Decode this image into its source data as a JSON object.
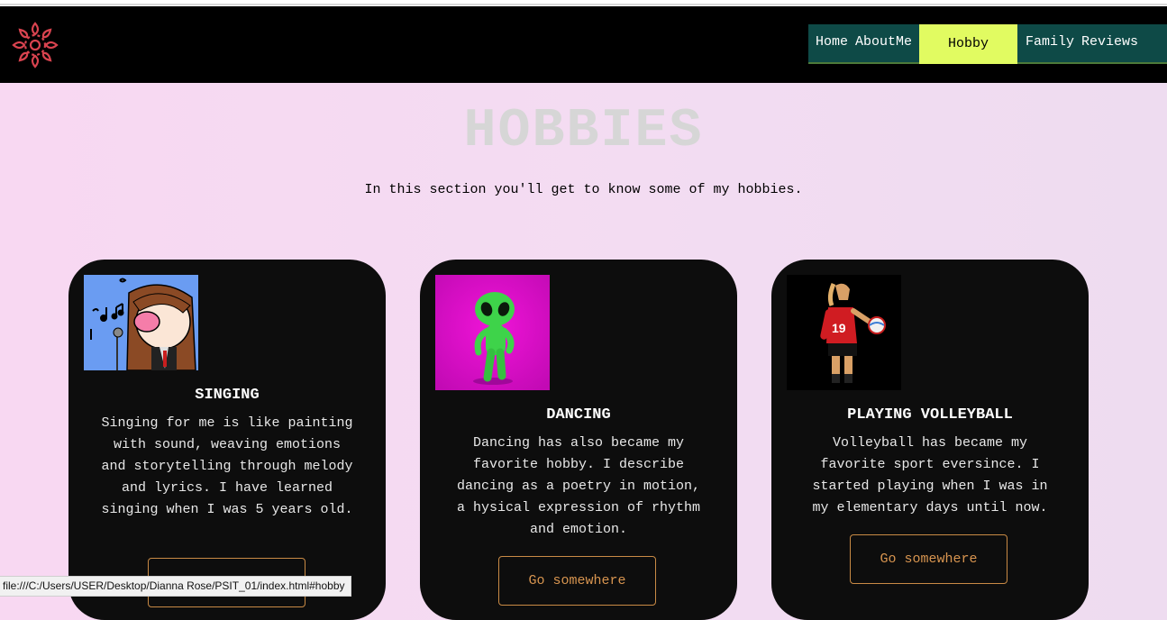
{
  "nav": {
    "items": [
      {
        "label": "Home"
      },
      {
        "label": "AboutMe"
      },
      {
        "label": "Hobby",
        "active": true
      },
      {
        "label": "Family"
      },
      {
        "label": "Reviews"
      }
    ]
  },
  "logo": {
    "icon": "mandala-logo-icon",
    "color": "#d9434f"
  },
  "hero": {
    "title": "HOBBIES",
    "intro": "In this section you'll get to know some of my hobbies."
  },
  "cards": [
    {
      "title": "SINGING",
      "text": "Singing for me is like painting with sound, weaving emotions and storytelling through melody and lyrics. I have learned singing when I was 5 years old.",
      "image": "anime-girl-singing-image"
    },
    {
      "title": "DANCING",
      "text": "Dancing has also became my favorite hobby. I describe dancing as a poetry in motion, a hysical expression of rhythm and emotion.",
      "button": "Go somewhere",
      "image": "green-alien-dancing-image"
    },
    {
      "title": "PLAYING VOLLEYBALL",
      "text": "Volleyball has became my favorite sport eversince. I started playing when I was in my elementary days until now.",
      "button": "Go somewhere",
      "image": "volleyball-player-image"
    }
  ],
  "statusbar": {
    "url": "file:///C:/Users/USER/Desktop/Dianna Rose/PSIT_01/index.html#hobby"
  },
  "colors": {
    "nav_bg": "#0e4a47",
    "nav_active": "#e1fb61",
    "card_bg": "#0d0d0d",
    "button_border": "#c98a45",
    "accent_orange": "#d89550"
  }
}
